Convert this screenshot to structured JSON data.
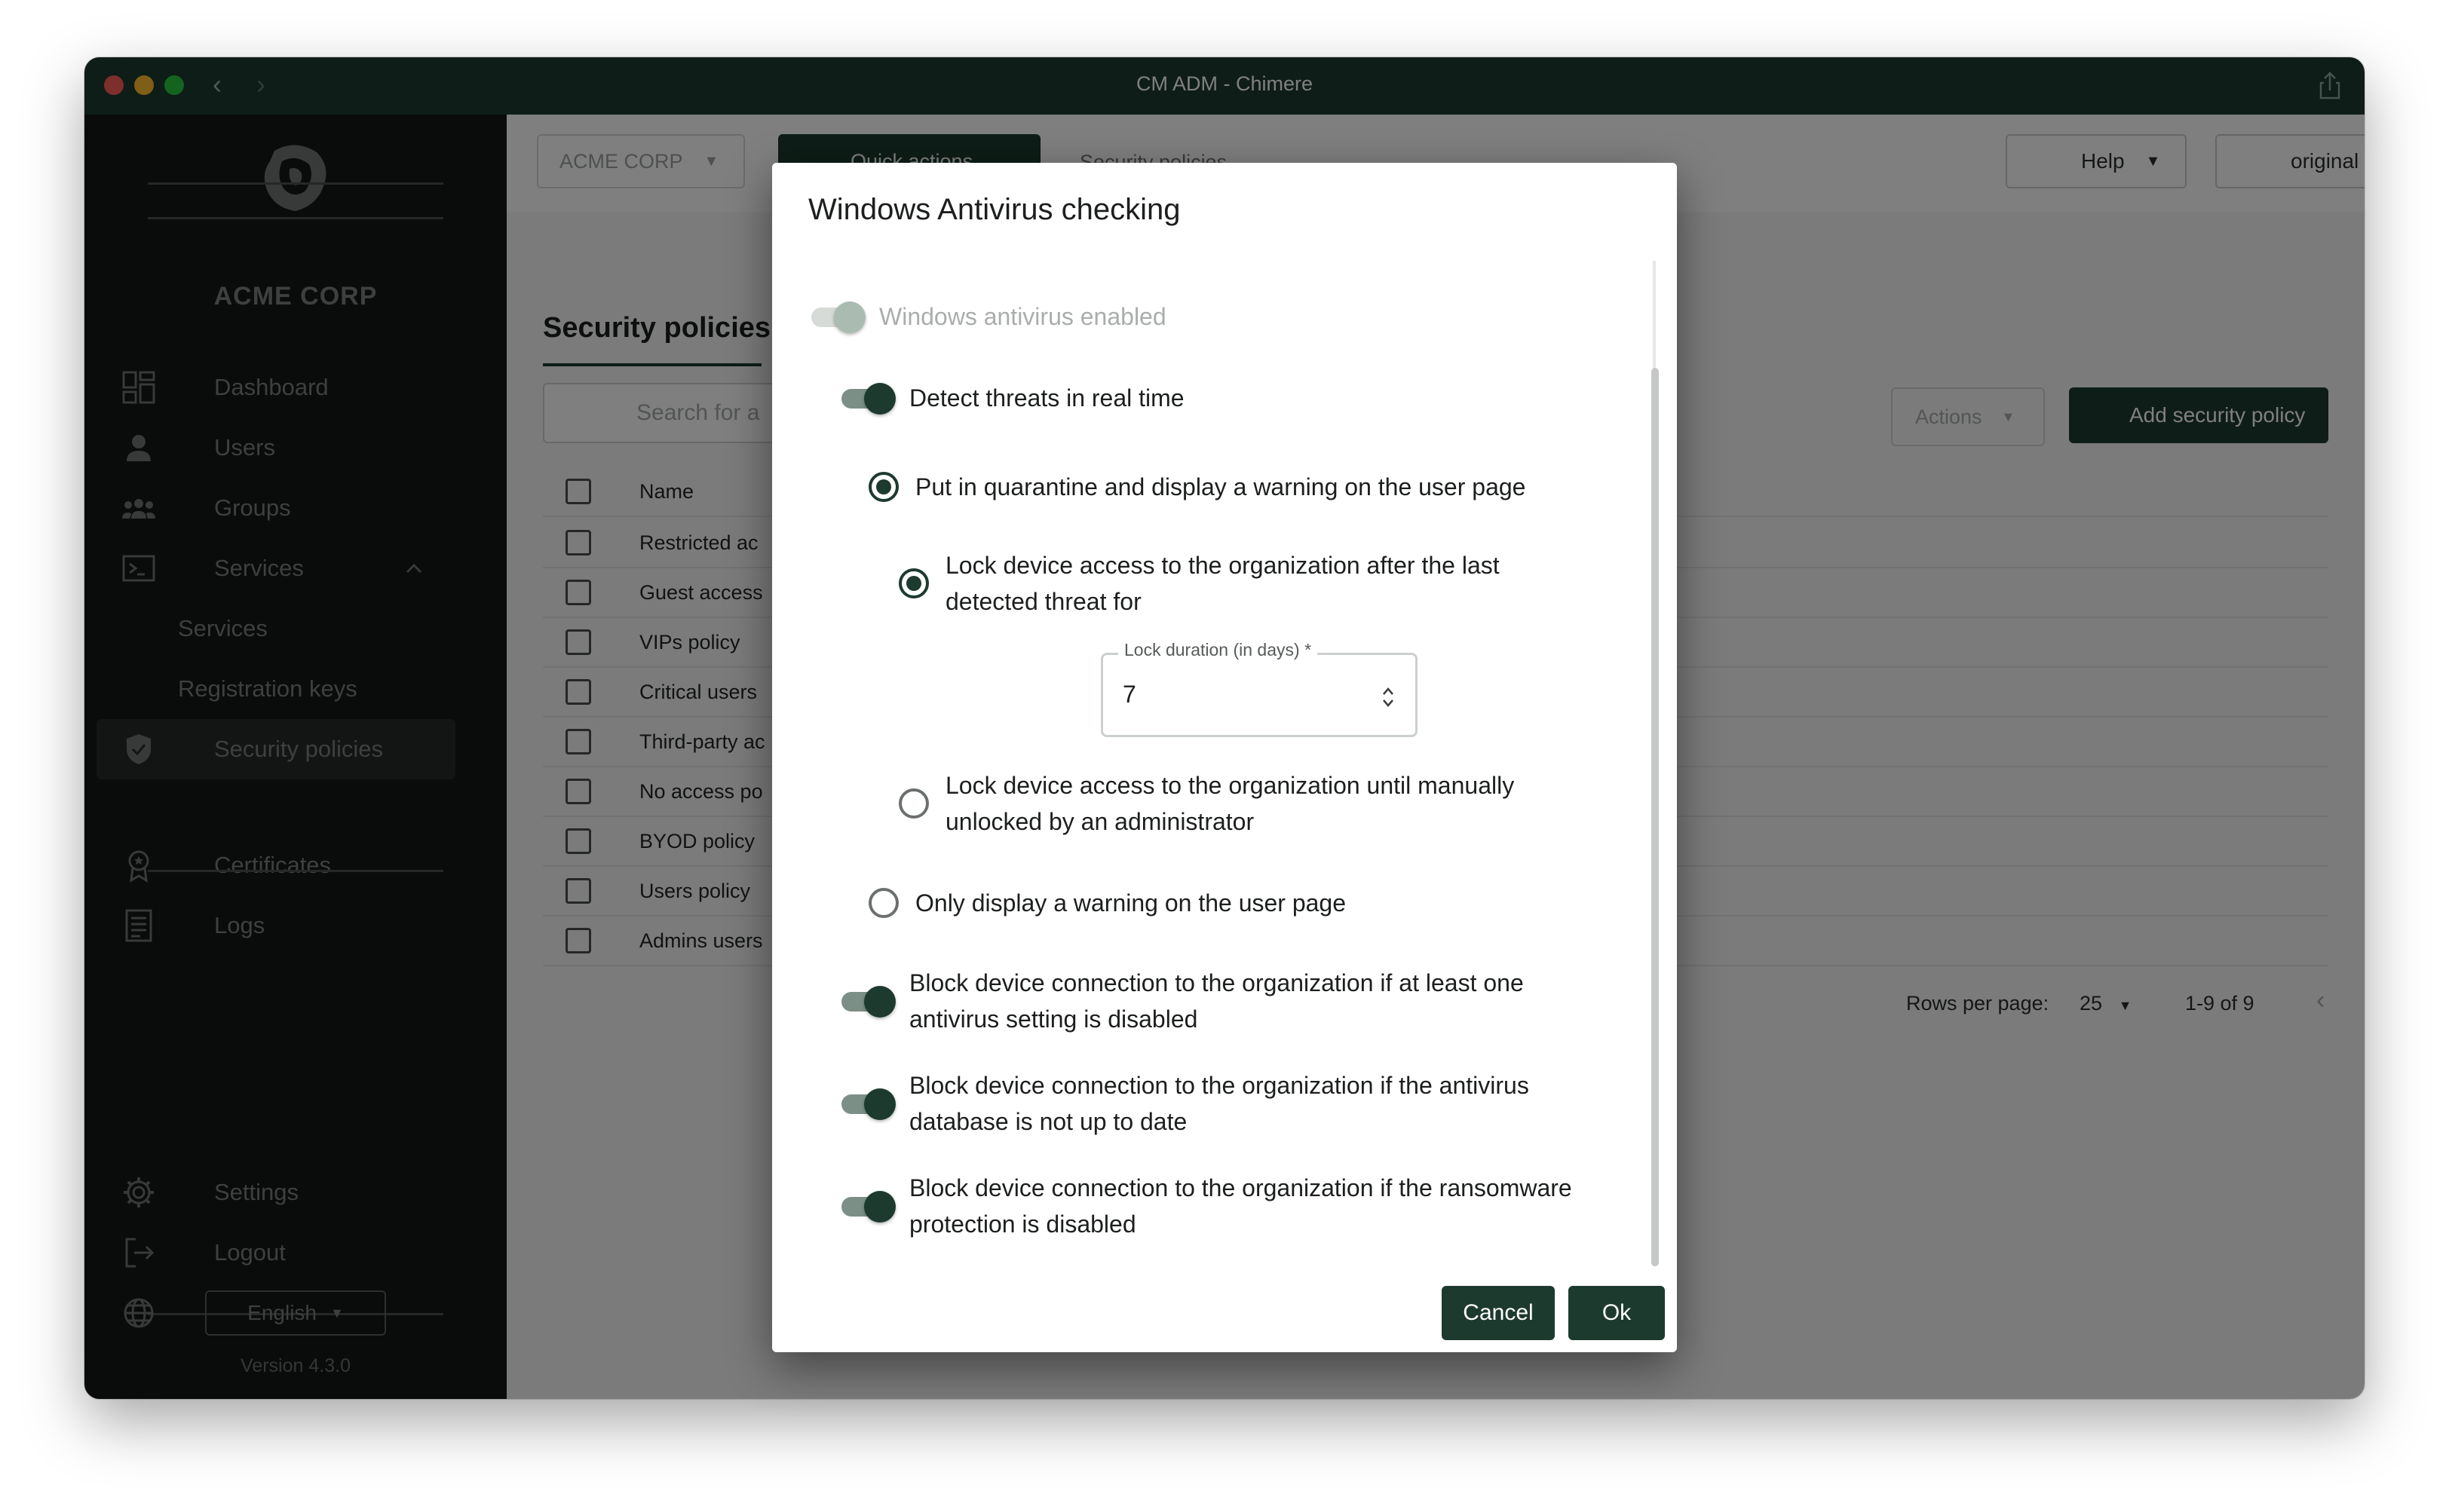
{
  "window": {
    "title": "CM ADM - Chimere"
  },
  "sidebar": {
    "org_name": "ACME CORP",
    "items": [
      {
        "label": "Dashboard",
        "icon": "dashboard-icon"
      },
      {
        "label": "Users",
        "icon": "user-icon"
      },
      {
        "label": "Groups",
        "icon": "groups-icon"
      },
      {
        "label": "Services",
        "icon": "terminal-icon"
      },
      {
        "label": "Services"
      },
      {
        "label": "Registration keys"
      },
      {
        "label": "Security policies",
        "icon": "shield-icon"
      },
      {
        "label": "Certificates",
        "icon": "certificate-icon"
      },
      {
        "label": "Logs",
        "icon": "logs-icon"
      },
      {
        "label": "Settings",
        "icon": "gear-icon"
      },
      {
        "label": "Logout",
        "icon": "logout-icon"
      }
    ],
    "language": "English",
    "version": "Version 4.3.0"
  },
  "header": {
    "org_select": "ACME CORP",
    "quick_actions": "Quick actions",
    "breadcrumb": "Security policies",
    "help": "Help",
    "user": "original"
  },
  "page": {
    "title": "Security policies",
    "search_placeholder": "Search for a",
    "actions": "Actions",
    "add_button": "Add security policy",
    "column_name": "Name",
    "rows": [
      "Restricted ac",
      "Guest access",
      "VIPs policy",
      "Critical users",
      "Third-party ac",
      "No access po",
      "BYOD policy",
      "Users policy",
      "Admins users"
    ],
    "rows_per_page_label": "Rows per page:",
    "rows_per_page_value": "25",
    "range": "1-9 of 9"
  },
  "dialog": {
    "title": "Windows Antivirus checking",
    "antivirus_enabled": "Windows antivirus enabled",
    "detect_realtime": "Detect threats in real time",
    "quarantine_option": "Put in quarantine and display a warning on the user page",
    "lock_after_threat_line1": "Lock device access to the organization after the last",
    "lock_after_threat_line2": "detected threat for",
    "lock_duration_label": "Lock duration (in days) *",
    "lock_duration_value": "7",
    "lock_manual_line1": "Lock device access to the organization until manually",
    "lock_manual_line2": "unlocked by an administrator",
    "warning_only": "Only display a warning on the user page",
    "block_setting_line1": "Block device connection to the organization if at least one",
    "block_setting_line2": "antivirus setting is disabled",
    "block_db_line1": "Block device connection to the organization if the antivirus",
    "block_db_line2": "database is not up to date",
    "block_ransomware_line1": "Block device connection to the organization if the ransomware",
    "block_ransomware_line2": "protection is disabled",
    "cancel": "Cancel",
    "ok": "Ok"
  },
  "colors": {
    "brand": "#1d3a2f",
    "sidebar_bg": "#141716"
  }
}
